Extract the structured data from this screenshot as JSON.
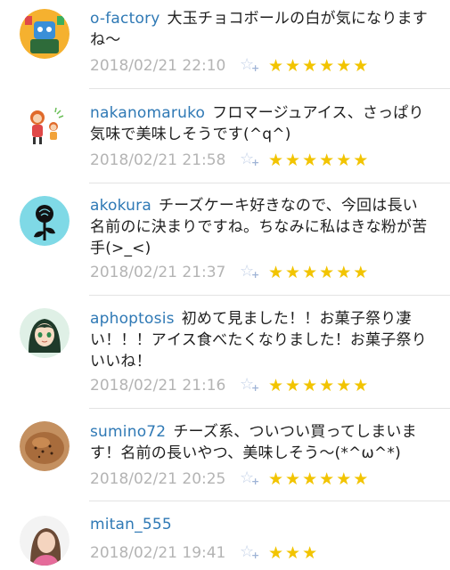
{
  "comments": [
    {
      "user": "o-factory",
      "text": "大玉チョコボールの白が気になりますね〜",
      "date": "2018/02/21 22:10",
      "star_count": 6,
      "avatar": "robot-illustration-avatar"
    },
    {
      "user": "nakanomaruko",
      "text": "フロマージュアイス、さっぱり気味で美味しそうです(^q^)",
      "date": "2018/02/21 21:58",
      "star_count": 6,
      "avatar": "cartoon-kids-avatar"
    },
    {
      "user": "akokura",
      "text": "チーズケーキ好きなので、今回は長い名前のに決まりですね。ちなみに私はきな粉が苦手(>_<)",
      "date": "2018/02/21 21:37",
      "star_count": 6,
      "avatar": "black-rose-avatar"
    },
    {
      "user": "aphoptosis",
      "text": "初めて見ました！！お菓子祭り凄い！！！アイス食べたくなりました！お菓子祭りいいね！",
      "date": "2018/02/21 21:16",
      "star_count": 6,
      "avatar": "anime-girl-avatar"
    },
    {
      "user": "sumino72",
      "text": "チーズ系、ついつい買ってしまいます！名前の長いやつ、美味しそう〜(*^ω^*)",
      "date": "2018/02/21 20:25",
      "star_count": 6,
      "avatar": "bread-photo-avatar"
    },
    {
      "user": "mitan_555",
      "text": "",
      "date": "2018/02/21 19:41",
      "star_count": 3,
      "avatar": "woman-photo-avatar"
    }
  ],
  "colors": {
    "username": "#2f79b5",
    "star": "#f2c400",
    "date": "#b4b4b4"
  },
  "icons": {
    "add_star": "add-star-icon",
    "star": "star-icon"
  }
}
